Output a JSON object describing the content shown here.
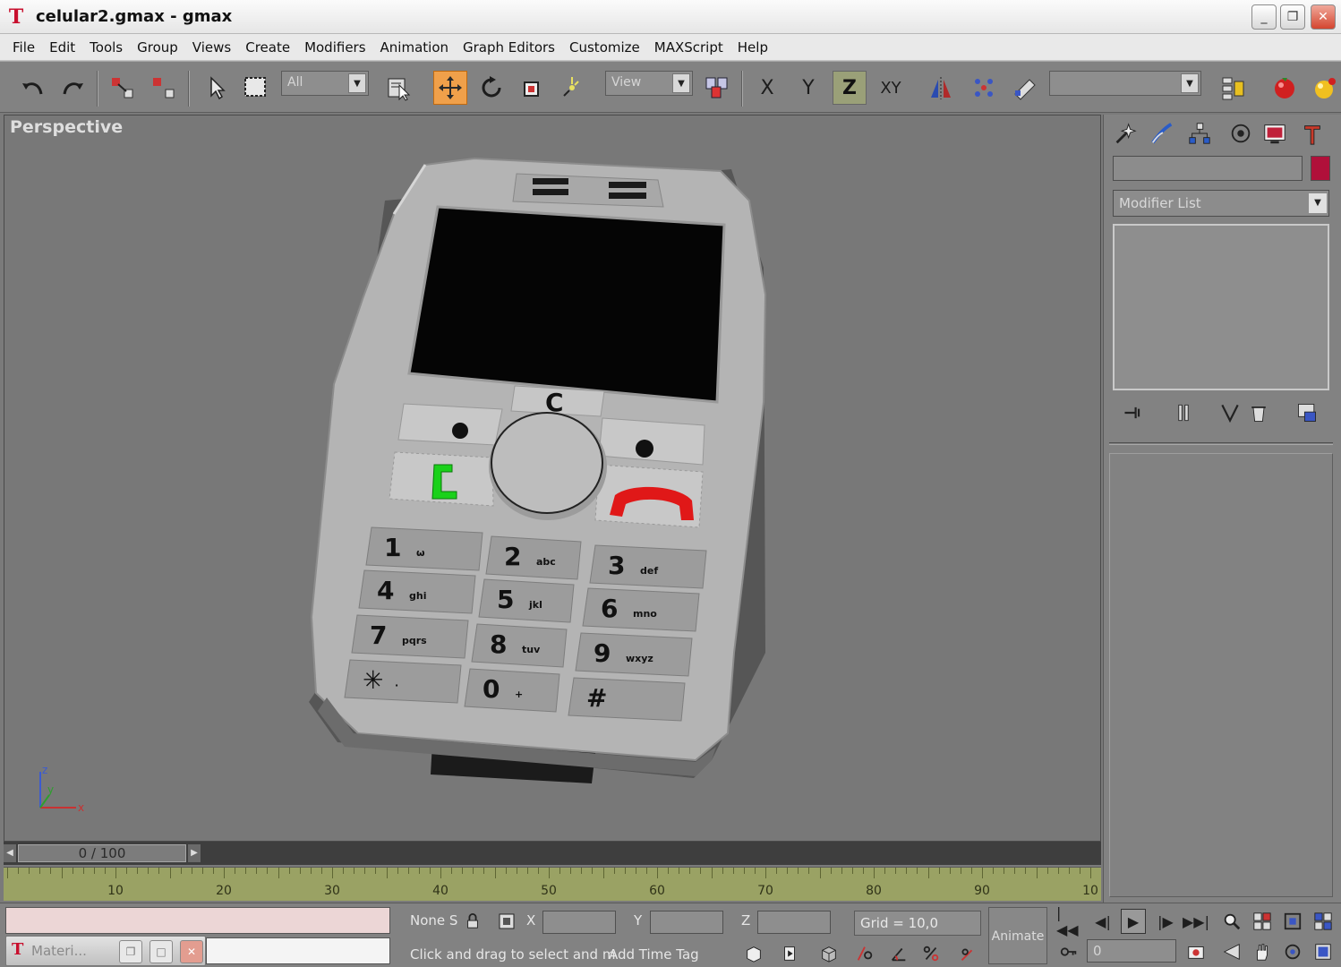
{
  "window": {
    "title": "celular2.gmax - gmax",
    "app_icon": "gmax-logo-icon",
    "controls": {
      "minimize": "_",
      "restore": "❐",
      "close": "✕"
    }
  },
  "menu": [
    "File",
    "Edit",
    "Tools",
    "Group",
    "Views",
    "Create",
    "Modifiers",
    "Animation",
    "Graph Editors",
    "Customize",
    "MAXScript",
    "Help"
  ],
  "toolbar": {
    "selection_filter": "All",
    "reference_coord": "View",
    "active_tool": "select-and-move",
    "active_axis": "Z",
    "axis_labels": {
      "x": "X",
      "y": "Y",
      "z": "Z",
      "xy": "XY"
    },
    "named_selection": ""
  },
  "viewport": {
    "label": "Perspective",
    "axis_labels": {
      "x": "x",
      "y": "y",
      "z": "z"
    }
  },
  "phone_keys": [
    {
      "digit": "1",
      "letters": "ω"
    },
    {
      "digit": "2",
      "letters": "abc"
    },
    {
      "digit": "3",
      "letters": "def"
    },
    {
      "digit": "4",
      "letters": "ghi"
    },
    {
      "digit": "5",
      "letters": "jkl"
    },
    {
      "digit": "6",
      "letters": "mno"
    },
    {
      "digit": "7",
      "letters": "pqrs"
    },
    {
      "digit": "8",
      "letters": "tuv"
    },
    {
      "digit": "9",
      "letters": "wxyz"
    },
    {
      "digit": "✳",
      "letters": "·"
    },
    {
      "digit": "0",
      "letters": "+"
    },
    {
      "digit": "#",
      "letters": ""
    }
  ],
  "phone": {
    "clear_label": "C"
  },
  "command_panel": {
    "tabs": [
      "create-icon",
      "modify-icon",
      "hierarchy-icon",
      "motion-icon",
      "display-icon",
      "utilities-icon"
    ],
    "object_name": "",
    "object_color": "#b0103a",
    "modifier_list": "Modifier List"
  },
  "timeline": {
    "slider_text": "0 / 100",
    "ticks": [
      "10",
      "20",
      "30",
      "40",
      "50",
      "60",
      "70",
      "80",
      "90",
      "10"
    ]
  },
  "status": {
    "selection": "None S",
    "x_label": "X",
    "y_label": "Y",
    "z_label": "Z",
    "x_value": "",
    "y_value": "",
    "z_value": "",
    "grid": "Grid = 10,0",
    "prompt": "Click and drag to select and m",
    "time_tag": "Add Time Tag",
    "animate_label": "Animate",
    "current_frame": "0"
  },
  "minimized_window": {
    "title": "Materi..."
  }
}
